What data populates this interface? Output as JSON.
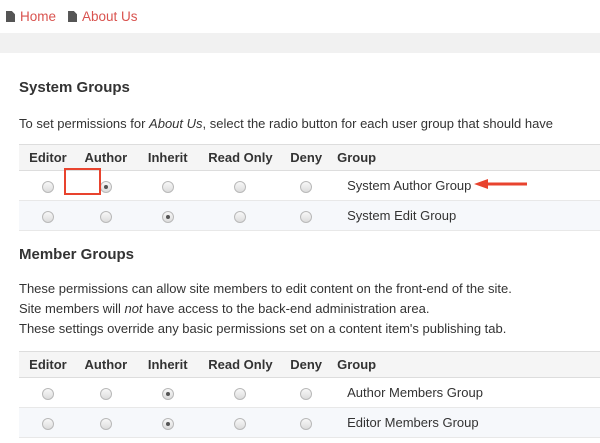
{
  "breadcrumb": [
    "Home",
    "About Us"
  ],
  "system": {
    "title": "System Groups",
    "description_pre": "To set permissions for ",
    "description_em": "About Us",
    "description_post": ", select the radio button for each user group that should have",
    "headers": [
      "Editor",
      "Author",
      "Inherit",
      "Read Only",
      "Deny",
      "Group"
    ],
    "rows": [
      {
        "group": "System Author Group",
        "selected": 1
      },
      {
        "group": "System Edit Group",
        "selected": 2
      }
    ]
  },
  "member": {
    "title": "Member Groups",
    "line1": "These permissions can allow site members to edit content on the front-end of the site.",
    "line2_pre": "Site members will ",
    "line2_em": "not",
    "line2_post": " have access to the back-end administration area.",
    "line3": "These settings override any basic permissions set on a content item's publishing tab.",
    "headers": [
      "Editor",
      "Author",
      "Inherit",
      "Read Only",
      "Deny",
      "Group"
    ],
    "rows": [
      {
        "group": "Author Members Group",
        "selected": 2
      },
      {
        "group": "Editor Members Group",
        "selected": 2
      }
    ]
  },
  "colors": {
    "link": "#d9534f",
    "annotation": "#e8432e"
  }
}
